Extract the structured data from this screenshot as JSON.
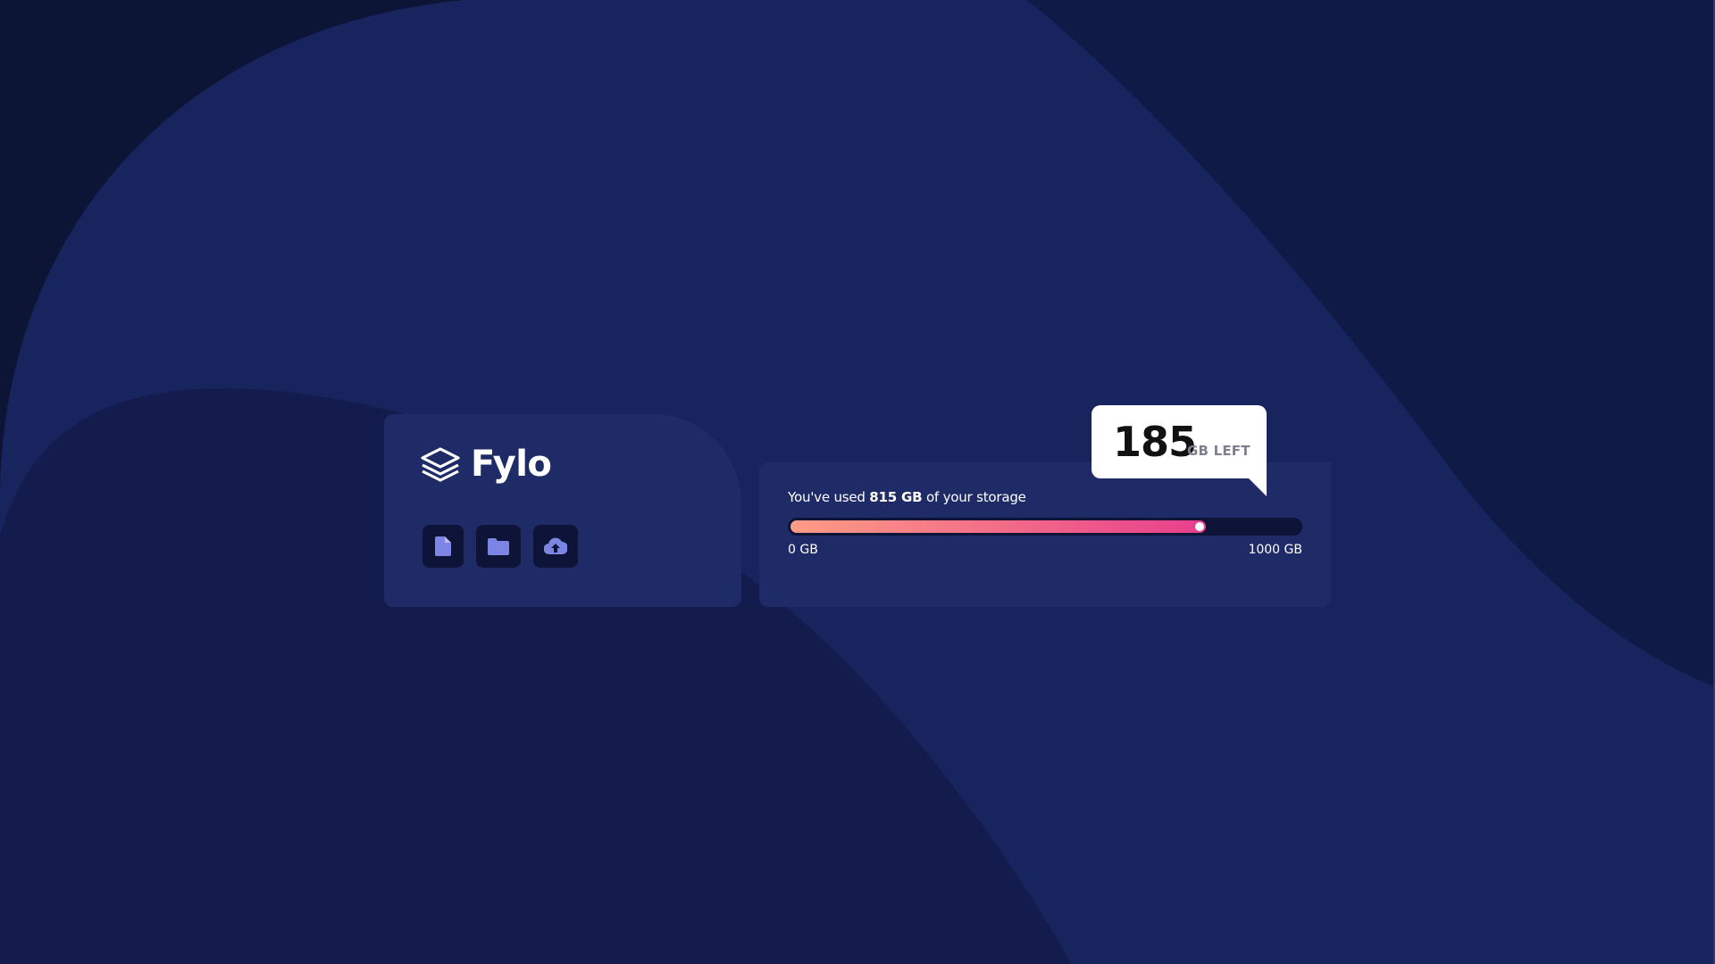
{
  "app": {
    "name": "Fylo",
    "logo_icon": "stacked-layers-icon"
  },
  "actions": [
    {
      "icon": "document-icon"
    },
    {
      "icon": "folder-icon"
    },
    {
      "icon": "upload-icon"
    }
  ],
  "storage": {
    "text_prefix": "You've used ",
    "used_label": "815 GB",
    "text_suffix": " of your storage",
    "used_value": 815,
    "total_value": 1000,
    "used_fraction": 0.815,
    "scale_min": "0 GB",
    "scale_max": "1000 GB",
    "remaining_value": "185",
    "remaining_unit": "GB LEFT"
  },
  "colors": {
    "background": "#111d4a",
    "card": "#1f2b66",
    "dark": "#0d1437",
    "gradient_start": "#fd9c85",
    "gradient_end": "#e83e8c",
    "icon": "#7d85e4"
  }
}
